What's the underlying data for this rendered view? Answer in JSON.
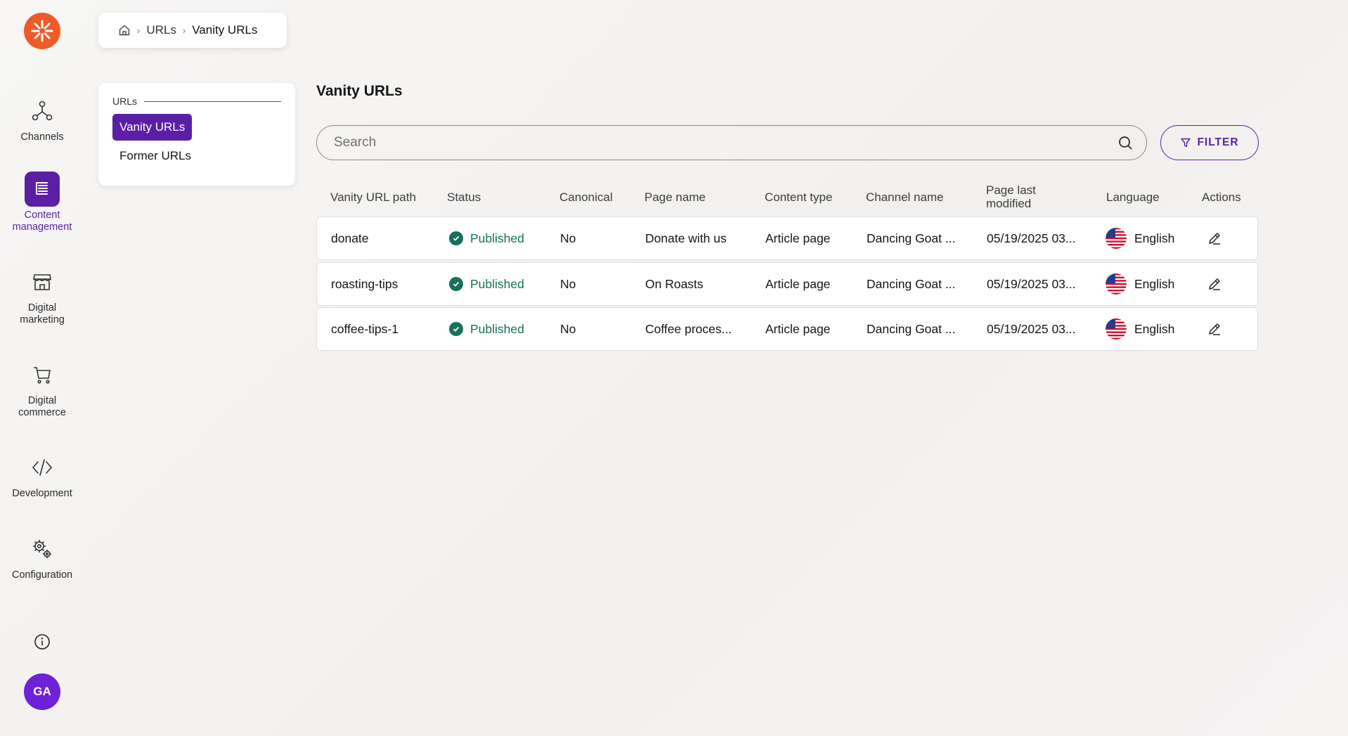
{
  "nav": {
    "items": [
      {
        "label_line1": "Channels",
        "label_line2": "",
        "icon": "channels-icon",
        "active": false
      },
      {
        "label_line1": "Content",
        "label_line2": "management",
        "icon": "content-management-icon",
        "active": true
      },
      {
        "label_line1": "Digital",
        "label_line2": "marketing",
        "icon": "storefront-icon",
        "active": false
      },
      {
        "label_line1": "Digital",
        "label_line2": "commerce",
        "icon": "cart-icon",
        "active": false
      },
      {
        "label_line1": "Development",
        "label_line2": "",
        "icon": "code-icon",
        "active": false
      },
      {
        "label_line1": "Configuration",
        "label_line2": "",
        "icon": "gears-icon",
        "active": false
      }
    ],
    "avatar_initials": "GA",
    "colors": {
      "accent": "#5b1fa6",
      "logo": "#f05a28",
      "avatar": "#6e21d8",
      "published": "#17705b"
    }
  },
  "breadcrumb": {
    "home_icon": "home-icon",
    "items": [
      "URLs",
      "Vanity URLs"
    ]
  },
  "submenu": {
    "group_label": "URLs",
    "items": [
      "Vanity URLs",
      "Former URLs"
    ],
    "active": "Vanity URLs"
  },
  "main": {
    "title": "Vanity URLs",
    "search_placeholder": "Search",
    "filter_label": "FILTER"
  },
  "table": {
    "columns": {
      "path": "Vanity URL path",
      "status": "Status",
      "canonical": "Canonical",
      "page_name": "Page name",
      "content_type": "Content type",
      "channel_name": "Channel name",
      "modified_line1": "Page last",
      "modified_line2": "modified",
      "language": "Language",
      "actions": "Actions"
    },
    "rows": [
      {
        "path": "donate",
        "status": "Published",
        "canonical": "No",
        "page_name": "Donate with us",
        "content_type": "Article page",
        "channel_name": "Dancing Goat ...",
        "modified": "05/19/2025 03...",
        "language": "English"
      },
      {
        "path": "roasting-tips",
        "status": "Published",
        "canonical": "No",
        "page_name": "On Roasts",
        "content_type": "Article page",
        "channel_name": "Dancing Goat ...",
        "modified": "05/19/2025 03...",
        "language": "English"
      },
      {
        "path": "coffee-tips-1",
        "status": "Published",
        "canonical": "No",
        "page_name": "Coffee proces...",
        "content_type": "Article page",
        "channel_name": "Dancing Goat ...",
        "modified": "05/19/2025 03...",
        "language": "English"
      }
    ]
  }
}
